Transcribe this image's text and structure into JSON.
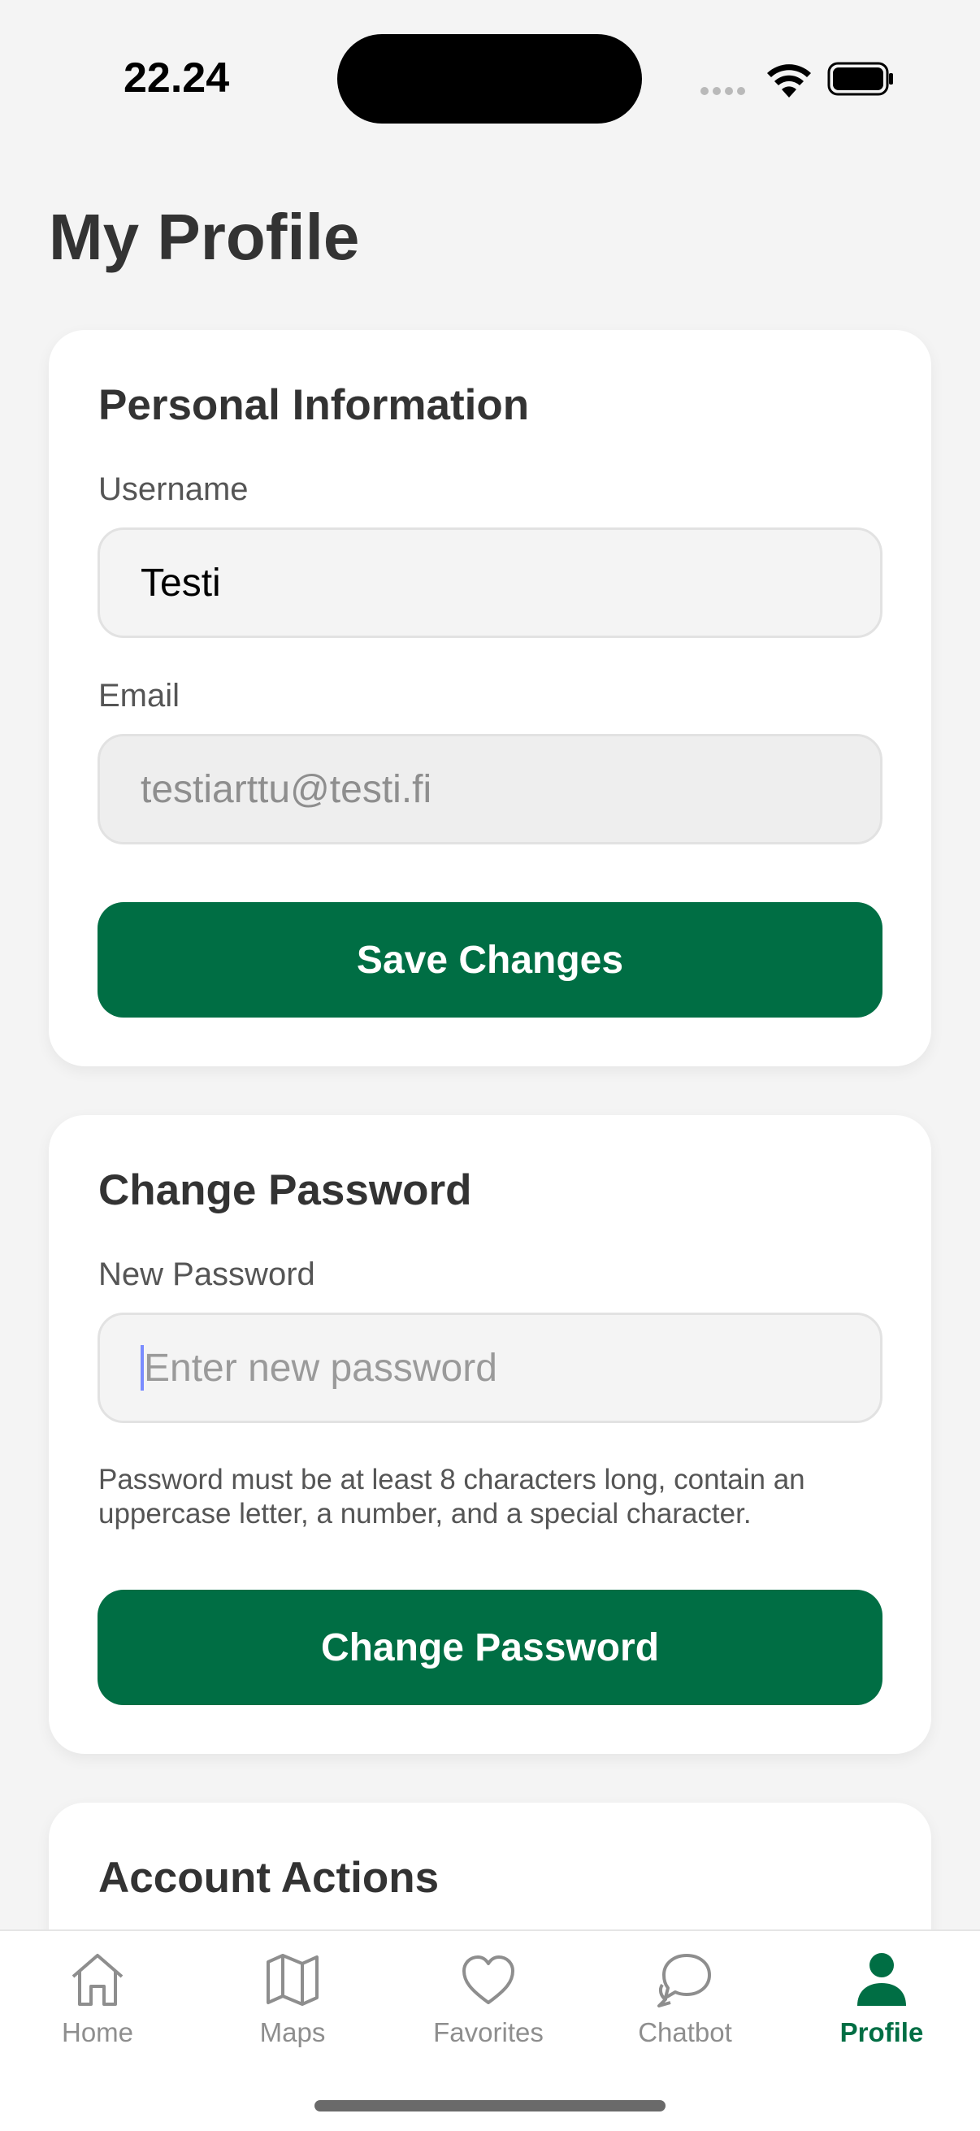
{
  "status_bar": {
    "time": "22.24"
  },
  "page": {
    "title": "My Profile"
  },
  "personal_info": {
    "title": "Personal Information",
    "username_label": "Username",
    "username_value": "Testi",
    "email_label": "Email",
    "email_value": "testiarttu@testi.fi",
    "save_button": "Save Changes"
  },
  "change_password": {
    "title": "Change Password",
    "new_password_label": "New Password",
    "new_password_placeholder": "Enter new password",
    "hint": "Password must be at least 8 characters long, contain an uppercase letter, a number, and a special character.",
    "button": "Change Password"
  },
  "account_actions": {
    "title": "Account Actions"
  },
  "tabs": [
    {
      "label": "Home",
      "icon": "home-icon"
    },
    {
      "label": "Maps",
      "icon": "map-icon"
    },
    {
      "label": "Favorites",
      "icon": "heart-icon"
    },
    {
      "label": "Chatbot",
      "icon": "chat-icon"
    },
    {
      "label": "Profile",
      "icon": "person-icon",
      "active": true
    }
  ],
  "colors": {
    "accent": "#006e44",
    "background": "#f4f4f4",
    "card": "#ffffff"
  }
}
